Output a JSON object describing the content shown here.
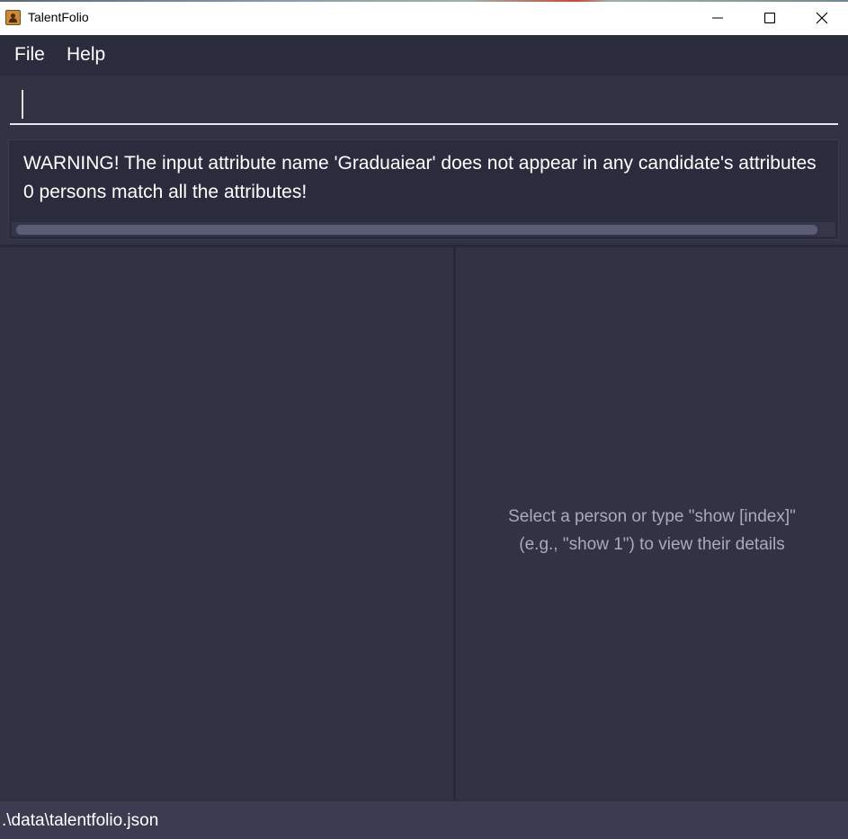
{
  "window": {
    "title": "TalentFolio",
    "controls": [
      "minimize-icon",
      "maximize-icon",
      "close-icon"
    ]
  },
  "menu": {
    "file_label": "File",
    "help_label": "Help"
  },
  "command": {
    "value": "",
    "placeholder": ""
  },
  "result": {
    "line1": "WARNING! The input attribute name 'Graduaiear' does not appear in any candidate's attributes",
    "line2": "0 persons match all the attributes!"
  },
  "detail_panel": {
    "placeholder_line1": "Select a person or type \"show [index]\"",
    "placeholder_line2": "(e.g., \"show 1\") to view their details"
  },
  "status": {
    "file_path": ".\\data\\talentfolio.json"
  },
  "colors": {
    "background": "#313244",
    "menubar": "#2a2b3d",
    "text": "#ffffff",
    "muted_text": "#a9abb8",
    "statusbar": "#3b3c52"
  }
}
